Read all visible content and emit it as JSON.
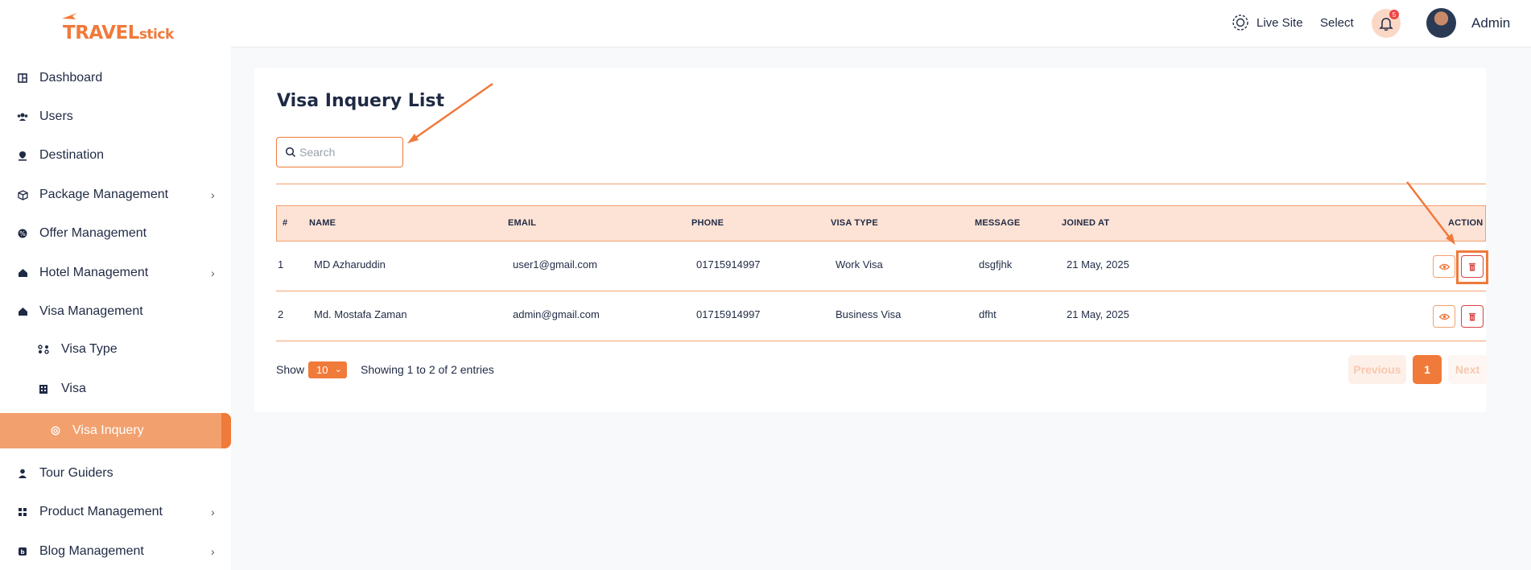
{
  "brand": {
    "logo_big": "TRAVEL",
    "logo_small": "stick",
    "color": "#f07a3a"
  },
  "sidebar": {
    "items": [
      {
        "label": "Dashboard",
        "icon": "dashboard-icon"
      },
      {
        "label": "Users",
        "icon": "users-icon"
      },
      {
        "label": "Destination",
        "icon": "location-pin-icon"
      },
      {
        "label": "Package Management",
        "icon": "box-icon",
        "chevron": "›"
      },
      {
        "label": "Offer Management",
        "icon": "offer-icon"
      },
      {
        "label": "Hotel Management",
        "icon": "hotel-icon",
        "chevron": "›"
      },
      {
        "label": "Visa Management",
        "icon": "home-icon"
      },
      {
        "label": "Visa Type",
        "icon": "visa-type-icon"
      },
      {
        "label": "Visa",
        "icon": "building-icon"
      },
      {
        "label": "Visa Inquery",
        "icon": "circle-icon"
      },
      {
        "label": "Tour Guiders",
        "icon": "guide-icon"
      },
      {
        "label": "Product Management",
        "icon": "grid-icon",
        "chevron": "›"
      },
      {
        "label": "Blog Management",
        "icon": "blog-icon",
        "chevron": "›"
      }
    ]
  },
  "header": {
    "live_site": "Live Site",
    "select": "Select",
    "notification_count": "5",
    "user_name": "Admin"
  },
  "main": {
    "title": "Visa Inquery List",
    "search_placeholder": "Search",
    "columns": [
      "#",
      "NAME",
      "EMAIL",
      "PHONE",
      "VISA TYPE",
      "MESSAGE",
      "JOINED AT",
      "ACTION"
    ],
    "rows": [
      {
        "num": "1",
        "name": "MD Azharuddin",
        "email": "user1@gmail.com",
        "phone": "01715914997",
        "visa_type": "Work Visa",
        "message": "dsgfjhk",
        "joined": "21 May, 2025"
      },
      {
        "num": "2",
        "name": "Md. Mostafa Zaman",
        "email": "admin@gmail.com",
        "phone": "01715914997",
        "visa_type": "Business Visa",
        "message": "dfht",
        "joined": "21 May, 2025"
      }
    ],
    "show_label": "Show",
    "page_length": "10",
    "entries_info": "Showing 1 to 2 of 2 entries",
    "pagination": {
      "previous": "Previous",
      "current": "1",
      "next": "Next"
    }
  },
  "colors": {
    "accent": "#f07a3a",
    "accent_light": "#fde3d6",
    "danger": "#d94141",
    "text": "#1f2a44"
  }
}
